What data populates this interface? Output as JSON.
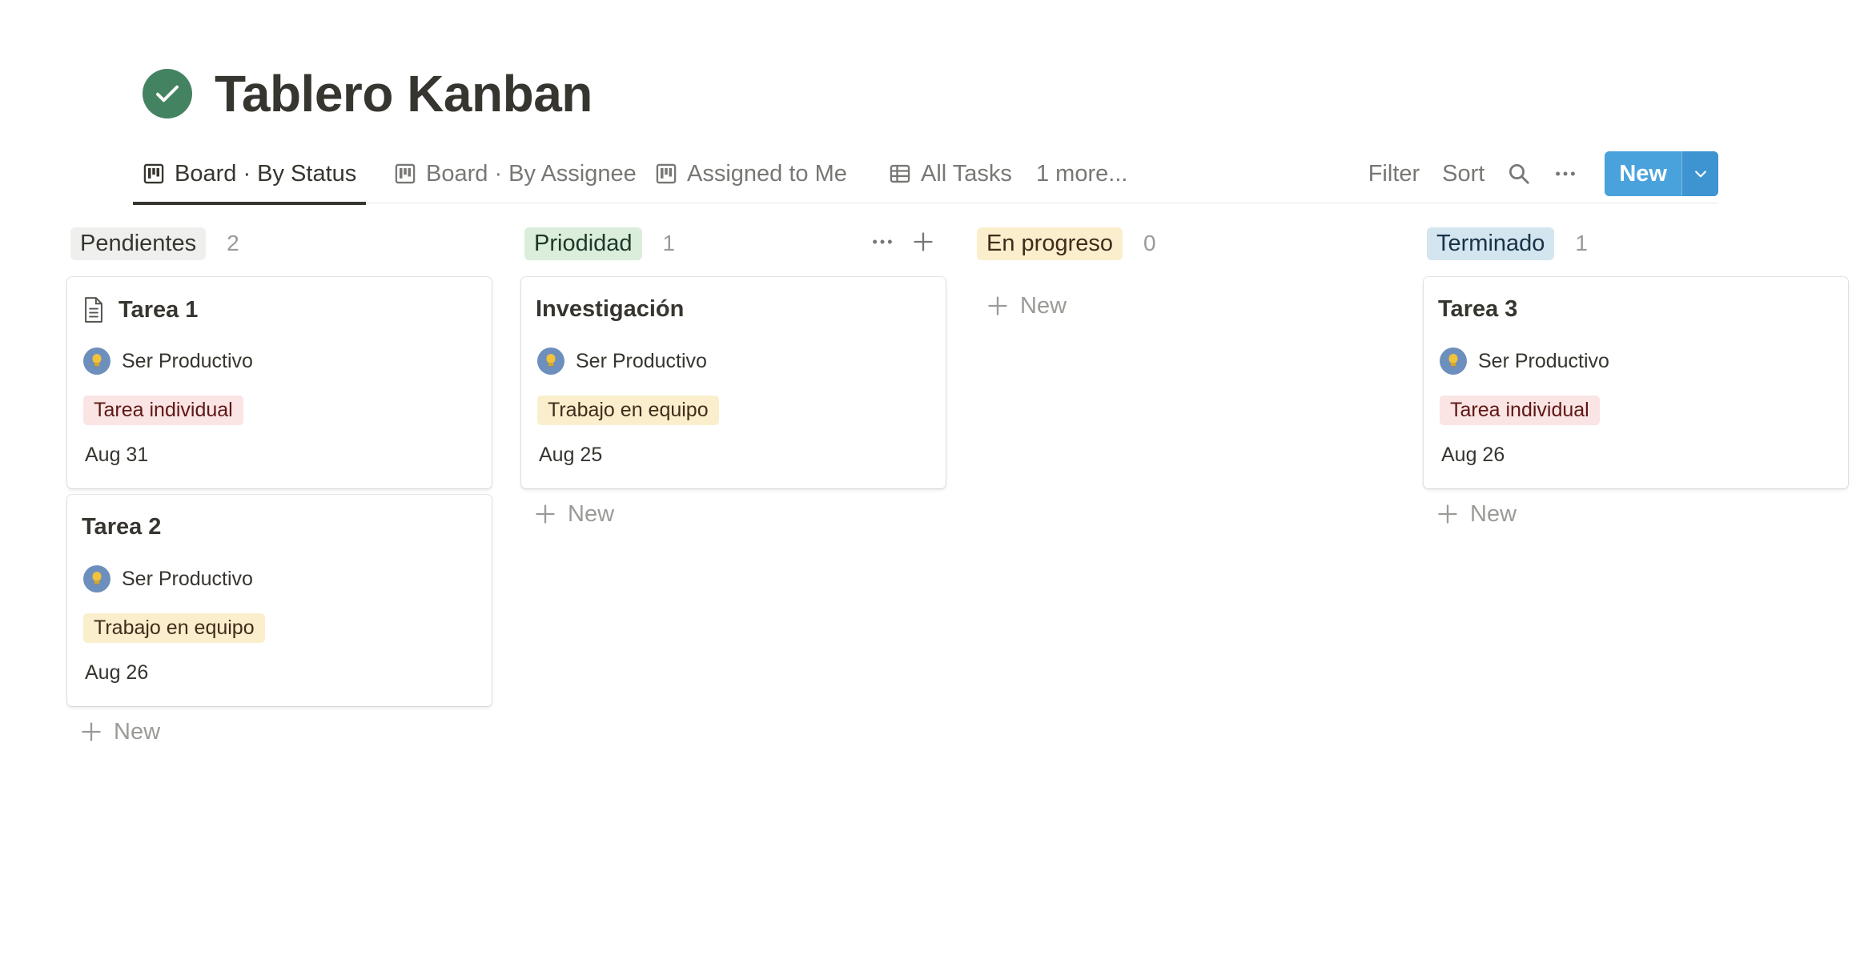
{
  "page": {
    "title": "Tablero Kanban",
    "title_icon": "check-circle-icon",
    "accent": "#448361"
  },
  "tabs": [
    {
      "label": "Board · By Status",
      "icon": "board-icon",
      "active": true
    },
    {
      "label": "Board · By Assignee",
      "icon": "board-icon",
      "active": false
    },
    {
      "label": "Assigned to Me",
      "icon": "board-icon",
      "active": false
    },
    {
      "label": "All Tasks",
      "icon": "table-icon",
      "active": false
    },
    {
      "label": "1 more...",
      "icon": "",
      "active": false
    }
  ],
  "toolbar": {
    "filter_label": "Filter",
    "sort_label": "Sort",
    "new_label": "New",
    "new_color": "#4aa2dc"
  },
  "columns": [
    {
      "name": "Pendientes",
      "count": "2",
      "pill_bg": "#efefed",
      "pill_fg": "#37352f",
      "cards": [
        {
          "title": "Tarea 1",
          "has_page_icon": true,
          "person": "Ser Productivo",
          "tag": "Tarea individual",
          "tag_bg": "#fbe4e4",
          "tag_fg": "#5d1715",
          "date": "Aug 31"
        },
        {
          "title": "Tarea 2",
          "has_page_icon": false,
          "person": "Ser Productivo",
          "tag": "Trabajo en equipo",
          "tag_bg": "#fbeecc",
          "tag_fg": "#402c1b",
          "date": "Aug 26"
        }
      ],
      "new_label": "New"
    },
    {
      "name": "Priodidad",
      "count": "1",
      "pill_bg": "#dbeddb",
      "pill_fg": "#1c3829",
      "cards": [
        {
          "title": "Investigación",
          "has_page_icon": false,
          "person": "Ser Productivo",
          "tag": "Trabajo en equipo",
          "tag_bg": "#fbeecc",
          "tag_fg": "#402c1b",
          "date": "Aug 25"
        }
      ],
      "new_label": "New"
    },
    {
      "name": "En progreso",
      "count": "0",
      "pill_bg": "#fbeecc",
      "pill_fg": "#402c1b",
      "cards": [],
      "new_label": "New"
    },
    {
      "name": "Terminado",
      "count": "1",
      "pill_bg": "#d3e5ef",
      "pill_fg": "#183347",
      "cards": [
        {
          "title": "Tarea 3",
          "has_page_icon": false,
          "person": "Ser Productivo",
          "tag": "Tarea individual",
          "tag_bg": "#fbe4e4",
          "tag_fg": "#5d1715",
          "date": "Aug 26"
        }
      ],
      "new_label": "New"
    }
  ]
}
